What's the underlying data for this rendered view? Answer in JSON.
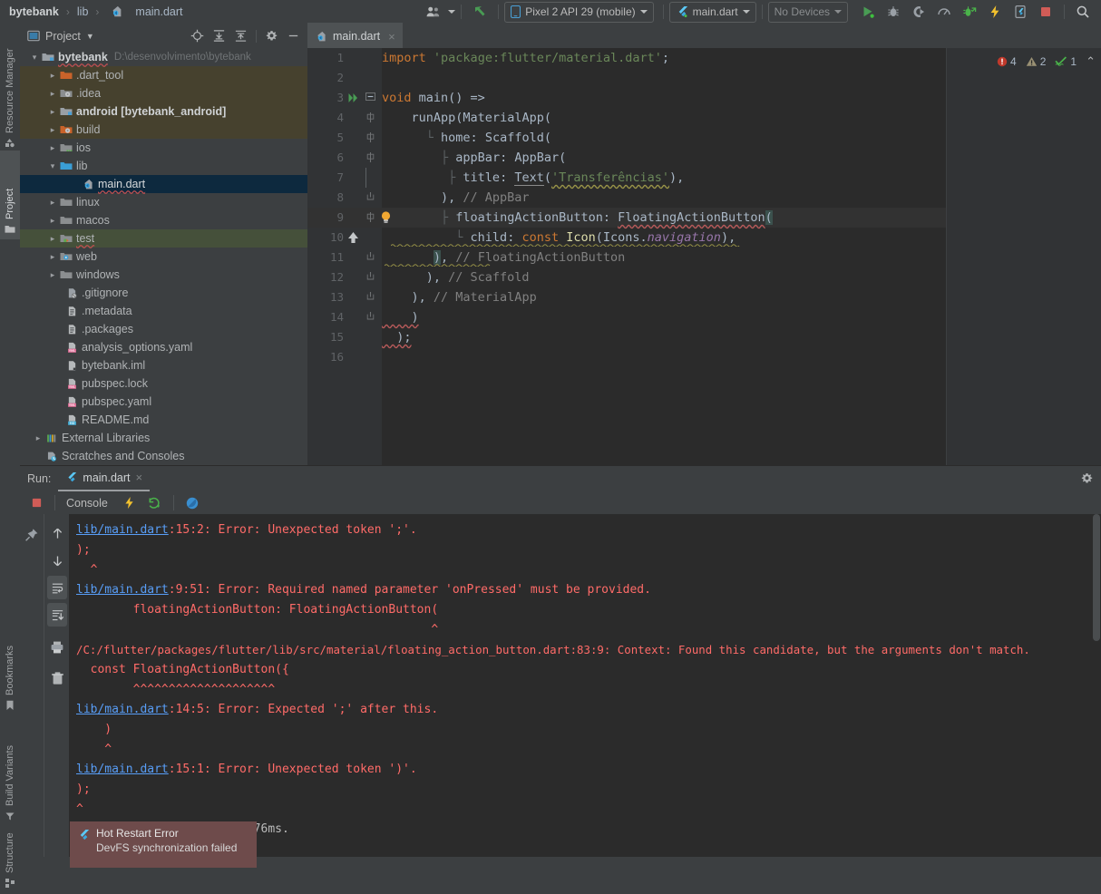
{
  "breadcrumb": {
    "items": [
      "bytebank",
      "lib",
      "main.dart"
    ],
    "separator": "›"
  },
  "toolbar": {
    "avatar_icon": "people-icon",
    "back_icon": "green-arrow-icon",
    "device_selector": {
      "label": "Pixel 2 API 29 (mobile)",
      "icon": "phone-icon"
    },
    "run_config": {
      "label": "main.dart",
      "icon": "flutter-icon"
    },
    "no_devices": {
      "label": "No Devices"
    },
    "buttons": [
      {
        "name": "run-button",
        "icon": "play-icon"
      },
      {
        "name": "debug-button",
        "icon": "bug-icon"
      },
      {
        "name": "run-with-coverage-button",
        "icon": "coverage-icon"
      },
      {
        "name": "profile-button",
        "icon": "gauge-icon"
      },
      {
        "name": "attach-debugger-button",
        "icon": "attach-icon"
      },
      {
        "name": "hot-reload-button",
        "icon": "lightning-icon"
      },
      {
        "name": "open-devtools-button",
        "icon": "devtools-icon"
      },
      {
        "name": "stop-button",
        "icon": "stop-square-icon"
      },
      {
        "name": "search-everywhere-button",
        "icon": "search-icon"
      }
    ]
  },
  "left_strip": {
    "top": [
      {
        "label": "Resource Manager",
        "icon": "resource-manager-icon",
        "active": false
      },
      {
        "label": "Project",
        "icon": "project-folder-icon",
        "active": true
      }
    ],
    "bottom": [
      {
        "label": "Bookmarks",
        "icon": "bookmark-icon"
      },
      {
        "label": "Build Variants",
        "icon": "build-variants-icon"
      },
      {
        "label": "Structure",
        "icon": "structure-icon"
      }
    ]
  },
  "project_panel": {
    "title": "Project",
    "title_caret": "▾",
    "actions": [
      {
        "name": "select-opened-file-button",
        "icon": "crosshair-icon"
      },
      {
        "name": "expand-all-button",
        "icon": "expand-all-icon"
      },
      {
        "name": "collapse-all-button",
        "icon": "collapse-all-icon"
      },
      {
        "name": "settings-button",
        "icon": "gear-icon"
      },
      {
        "name": "hide-button",
        "icon": "minus-icon"
      }
    ],
    "tree": [
      {
        "label": "bytebank",
        "sub": "D:\\desenvolvimento\\bytebank",
        "indent": 0,
        "arrow": "down",
        "icon": "module-folder-icon",
        "bold": true,
        "highlight": "none",
        "wavy": true
      },
      {
        "label": ".dart_tool",
        "indent": 1,
        "arrow": "right",
        "icon": "excluded-folder-icon",
        "highlight": "brown"
      },
      {
        "label": ".idea",
        "indent": 1,
        "arrow": "right",
        "icon": "settings-folder-icon",
        "highlight": "brown"
      },
      {
        "label": "android [bytebank_android]",
        "indent": 1,
        "arrow": "right",
        "icon": "module-folder-icon",
        "highlight": "brown",
        "bold_tail": true
      },
      {
        "label": "build",
        "indent": 1,
        "arrow": "right",
        "icon": "excluded-settings-folder-icon",
        "highlight": "brown"
      },
      {
        "label": "ios",
        "indent": 1,
        "arrow": "right",
        "icon": "source-folder-icon",
        "highlight": "none"
      },
      {
        "label": "lib",
        "indent": 1,
        "arrow": "down",
        "icon": "sources-root-folder-icon",
        "highlight": "none"
      },
      {
        "label": "main.dart",
        "indent": 3,
        "arrow": "none",
        "icon": "dart-file-icon",
        "highlight": "selected",
        "wavy": true
      },
      {
        "label": "linux",
        "indent": 1,
        "arrow": "right",
        "icon": "folder-icon",
        "highlight": "none"
      },
      {
        "label": "macos",
        "indent": 1,
        "arrow": "right",
        "icon": "folder-icon",
        "highlight": "none"
      },
      {
        "label": "test",
        "indent": 1,
        "arrow": "right",
        "icon": "test-folder-icon",
        "highlight": "green",
        "wavy": true
      },
      {
        "label": "web",
        "indent": 1,
        "arrow": "right",
        "icon": "web-folder-icon",
        "highlight": "none"
      },
      {
        "label": "windows",
        "indent": 1,
        "arrow": "right",
        "icon": "folder-icon",
        "highlight": "none"
      },
      {
        "label": ".gitignore",
        "indent": 2,
        "arrow": "none",
        "icon": "gitignore-file-icon",
        "highlight": "none"
      },
      {
        "label": ".metadata",
        "indent": 2,
        "arrow": "none",
        "icon": "text-file-icon",
        "highlight": "none"
      },
      {
        "label": ".packages",
        "indent": 2,
        "arrow": "none",
        "icon": "text-file-icon",
        "highlight": "none"
      },
      {
        "label": "analysis_options.yaml",
        "indent": 2,
        "arrow": "none",
        "icon": "yaml-file-icon",
        "highlight": "none"
      },
      {
        "label": "bytebank.iml",
        "indent": 2,
        "arrow": "none",
        "icon": "iml-file-icon",
        "highlight": "none"
      },
      {
        "label": "pubspec.lock",
        "indent": 2,
        "arrow": "none",
        "icon": "yaml-file-icon",
        "highlight": "none"
      },
      {
        "label": "pubspec.yaml",
        "indent": 2,
        "arrow": "none",
        "icon": "yaml-file-icon",
        "highlight": "none"
      },
      {
        "label": "README.md",
        "indent": 2,
        "arrow": "none",
        "icon": "markdown-file-icon",
        "highlight": "none"
      },
      {
        "label": "External Libraries",
        "indent": 0,
        "arrow": "right",
        "icon": "libraries-icon",
        "highlight": "none"
      },
      {
        "label": "Scratches and Consoles",
        "indent": 0,
        "arrow": "none",
        "icon": "scratches-icon",
        "highlight": "none"
      }
    ]
  },
  "editor": {
    "tab": {
      "label": "main.dart",
      "icon": "dart-file-icon",
      "close": "×"
    },
    "inspections": {
      "errors": "4",
      "warnings": "2",
      "checks": "1",
      "collapse": "⌃"
    },
    "lines": [
      {
        "num": "1",
        "gutter": "none",
        "fold": "none",
        "caret": false
      },
      {
        "num": "2",
        "gutter": "none",
        "fold": "none",
        "caret": false
      },
      {
        "num": "3",
        "gutter": "run",
        "fold": "open",
        "caret": false
      },
      {
        "num": "4",
        "gutter": "none",
        "fold": "mid",
        "caret": false
      },
      {
        "num": "5",
        "gutter": "none",
        "fold": "mid",
        "caret": false
      },
      {
        "num": "6",
        "gutter": "none",
        "fold": "mid",
        "caret": false
      },
      {
        "num": "7",
        "gutter": "none",
        "fold": "none",
        "caret": false
      },
      {
        "num": "8",
        "gutter": "none",
        "fold": "close",
        "caret": false
      },
      {
        "num": "9",
        "gutter": "bulb",
        "fold": "mid",
        "caret": true
      },
      {
        "num": "10",
        "gutter": "arrow",
        "fold": "none",
        "caret": false
      },
      {
        "num": "11",
        "gutter": "none",
        "fold": "close",
        "caret": false
      },
      {
        "num": "12",
        "gutter": "none",
        "fold": "close",
        "caret": false
      },
      {
        "num": "13",
        "gutter": "none",
        "fold": "close",
        "caret": false
      },
      {
        "num": "14",
        "gutter": "none",
        "fold": "close",
        "caret": false
      },
      {
        "num": "15",
        "gutter": "none",
        "fold": "none",
        "caret": false
      },
      {
        "num": "16",
        "gutter": "none",
        "fold": "none",
        "caret": false
      }
    ],
    "code": [
      "import 'package:flutter/material.dart';",
      "",
      "void main() =>",
      "    runApp(MaterialApp(",
      "      home: Scaffold(",
      "        appBar: AppBar(",
      "          title: Text('Transferências'),",
      "        ), // AppBar",
      "        floatingActionButton: FloatingActionButton(",
      "          child: const Icon(Icons.navigation),",
      "        ), // FloatingActionButton",
      "      ), // Scaffold",
      "    ), // MaterialApp",
      "    )",
      "  );",
      ""
    ]
  },
  "run_panel": {
    "label": "Run:",
    "tab": {
      "label": "main.dart",
      "icon": "flutter-icon",
      "close": "×"
    },
    "settings_icon": "gear-icon",
    "subtabs": {
      "stop_icon": "stop-square-icon",
      "console_label": "Console",
      "hot_reload_icon": "lightning-icon",
      "hot_restart_icon": "restart-icon",
      "flutter_inspector_icon": "dart-globe-icon"
    },
    "side_buttons": [
      {
        "name": "pin-tab-button",
        "icon": "pin-icon"
      },
      {
        "name": "previous-occurrence-button",
        "icon": "arrow-up-icon"
      },
      {
        "name": "next-occurrence-button",
        "icon": "arrow-down-icon"
      },
      {
        "name": "soft-wrap-button",
        "icon": "soft-wrap-icon",
        "active": true
      },
      {
        "name": "scroll-to-end-button",
        "icon": "scroll-to-end-icon",
        "active": true
      },
      {
        "name": "print-button",
        "icon": "printer-icon"
      },
      {
        "name": "clear-all-button",
        "icon": "trash-icon"
      }
    ],
    "console": [
      {
        "link": "lib/main.dart",
        "text": ":15:2: Error: Unexpected token ';'."
      },
      {
        "text": ");"
      },
      {
        "text": "  ^"
      },
      {
        "text": ""
      },
      {
        "link": "lib/main.dart",
        "text": ":9:51: Error: Required named parameter 'onPressed' must be provided."
      },
      {
        "text": "        floatingActionButton: FloatingActionButton("
      },
      {
        "text": "                                                  ^"
      },
      {
        "text": ""
      },
      {
        "text": "/C:/flutter/packages/flutter/lib/src/material/floating_action_button.dart:83:9: Context: Found this candidate, but the arguments don't match."
      },
      {
        "text": "  const FloatingActionButton({"
      },
      {
        "text": "        ^^^^^^^^^^^^^^^^^^^^"
      },
      {
        "text": ""
      },
      {
        "link": "lib/main.dart",
        "text": ":14:5: Error: Expected ';' after this."
      },
      {
        "text": "    )"
      },
      {
        "text": "    ^"
      },
      {
        "text": ""
      },
      {
        "link": "lib/main.dart",
        "text": ":15:1: Error: Unexpected token ')'."
      },
      {
        "text": ");"
      },
      {
        "text": "^"
      },
      {
        "text": ""
      },
      {
        "text": "                     in 576ms."
      }
    ]
  },
  "notification": {
    "icon": "flutter-icon",
    "title": "Hot Restart Error",
    "message": "DevFS synchronization failed"
  },
  "colors": {
    "panel_bg": "#3c3f41",
    "editor_bg": "#2b2b2b",
    "selection_blue": "#0d293e",
    "error_red": "#ff6b68",
    "link_blue": "#589df6",
    "keyword_orange": "#cc7832",
    "string_green": "#6a8759",
    "notification_bg": "#6e4b4b"
  }
}
